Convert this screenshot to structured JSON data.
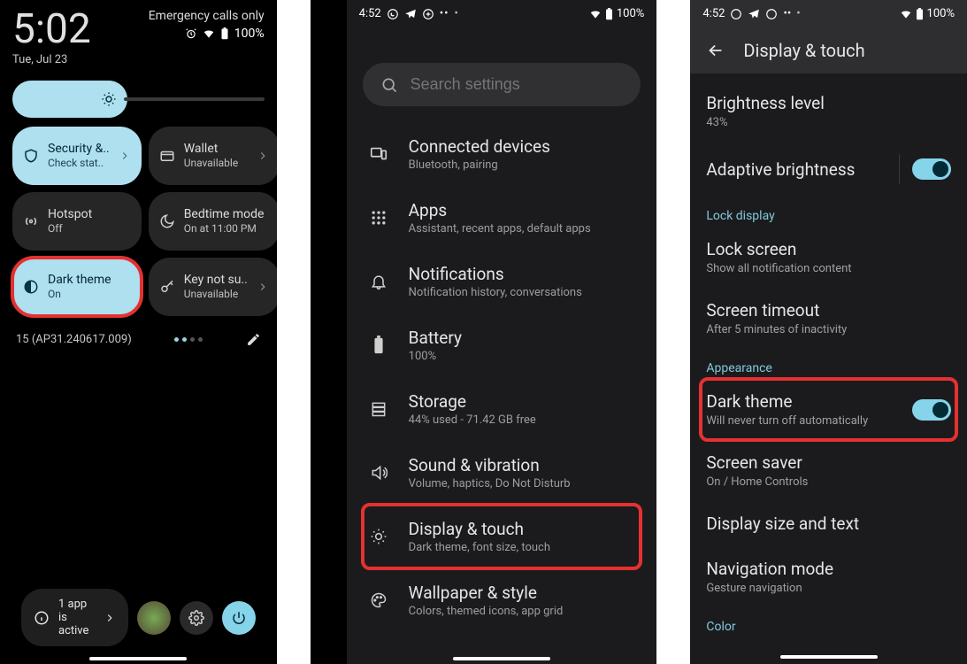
{
  "phone1": {
    "time": "5:02",
    "date": "Tue, Jul 23",
    "emergency": "Emergency calls only",
    "battery": "100%",
    "tiles": [
      {
        "id": "security",
        "title": "Security &..",
        "sub": "Check stat..",
        "on": true,
        "chevron": true,
        "icon": "shield"
      },
      {
        "id": "wallet",
        "title": "Wallet",
        "sub": "Unavailable",
        "on": false,
        "chevron": true,
        "icon": "wallet"
      },
      {
        "id": "hotspot",
        "title": "Hotspot",
        "sub": "Off",
        "on": false,
        "chevron": false,
        "icon": "hotspot"
      },
      {
        "id": "bedtime",
        "title": "Bedtime mode",
        "sub": "On at 11:00 PM",
        "on": false,
        "chevron": false,
        "icon": "bedtime"
      },
      {
        "id": "darktheme",
        "title": "Dark theme",
        "sub": "On",
        "on": true,
        "chevron": false,
        "icon": "darktheme",
        "highlighted": true
      },
      {
        "id": "keynot",
        "title": "Key not su..",
        "sub": "Unavailable",
        "on": false,
        "chevron": true,
        "icon": "key"
      }
    ],
    "build": "15 (AP31.240617.009)",
    "apps_active": "1 app is active"
  },
  "phone2": {
    "status_time": "4:52",
    "status_battery": "100%",
    "search_placeholder": "Search settings",
    "items": [
      {
        "id": "connected",
        "title": "Connected devices",
        "sub": "Bluetooth, pairing",
        "icon": "devices"
      },
      {
        "id": "apps",
        "title": "Apps",
        "sub": "Assistant, recent apps, default apps",
        "icon": "apps"
      },
      {
        "id": "notifications",
        "title": "Notifications",
        "sub": "Notification history, conversations",
        "icon": "bell"
      },
      {
        "id": "battery",
        "title": "Battery",
        "sub": "100%",
        "icon": "battery"
      },
      {
        "id": "storage",
        "title": "Storage",
        "sub": "44% used - 71.42 GB free",
        "icon": "storage"
      },
      {
        "id": "sound",
        "title": "Sound & vibration",
        "sub": "Volume, haptics, Do Not Disturb",
        "icon": "sound"
      },
      {
        "id": "display",
        "title": "Display & touch",
        "sub": "Dark theme, font size, touch",
        "icon": "display",
        "highlighted": true
      },
      {
        "id": "wallpaper",
        "title": "Wallpaper & style",
        "sub": "Colors, themed icons, app grid",
        "icon": "palette"
      }
    ]
  },
  "phone3": {
    "status_time": "4:52",
    "status_battery": "100%",
    "header": "Display & touch",
    "brightness_title": "Brightness level",
    "brightness_value": "43%",
    "adaptive_title": "Adaptive brightness",
    "section_lock": "Lock display",
    "lockscreen_title": "Lock screen",
    "lockscreen_sub": "Show all notification content",
    "timeout_title": "Screen timeout",
    "timeout_sub": "After 5 minutes of inactivity",
    "section_appearance": "Appearance",
    "dark_title": "Dark theme",
    "dark_sub": "Will never turn off automatically",
    "saver_title": "Screen saver",
    "saver_sub": "On / Home Controls",
    "displaysize_title": "Display size and text",
    "nav_title": "Navigation mode",
    "nav_sub": "Gesture navigation",
    "section_color": "Color"
  }
}
